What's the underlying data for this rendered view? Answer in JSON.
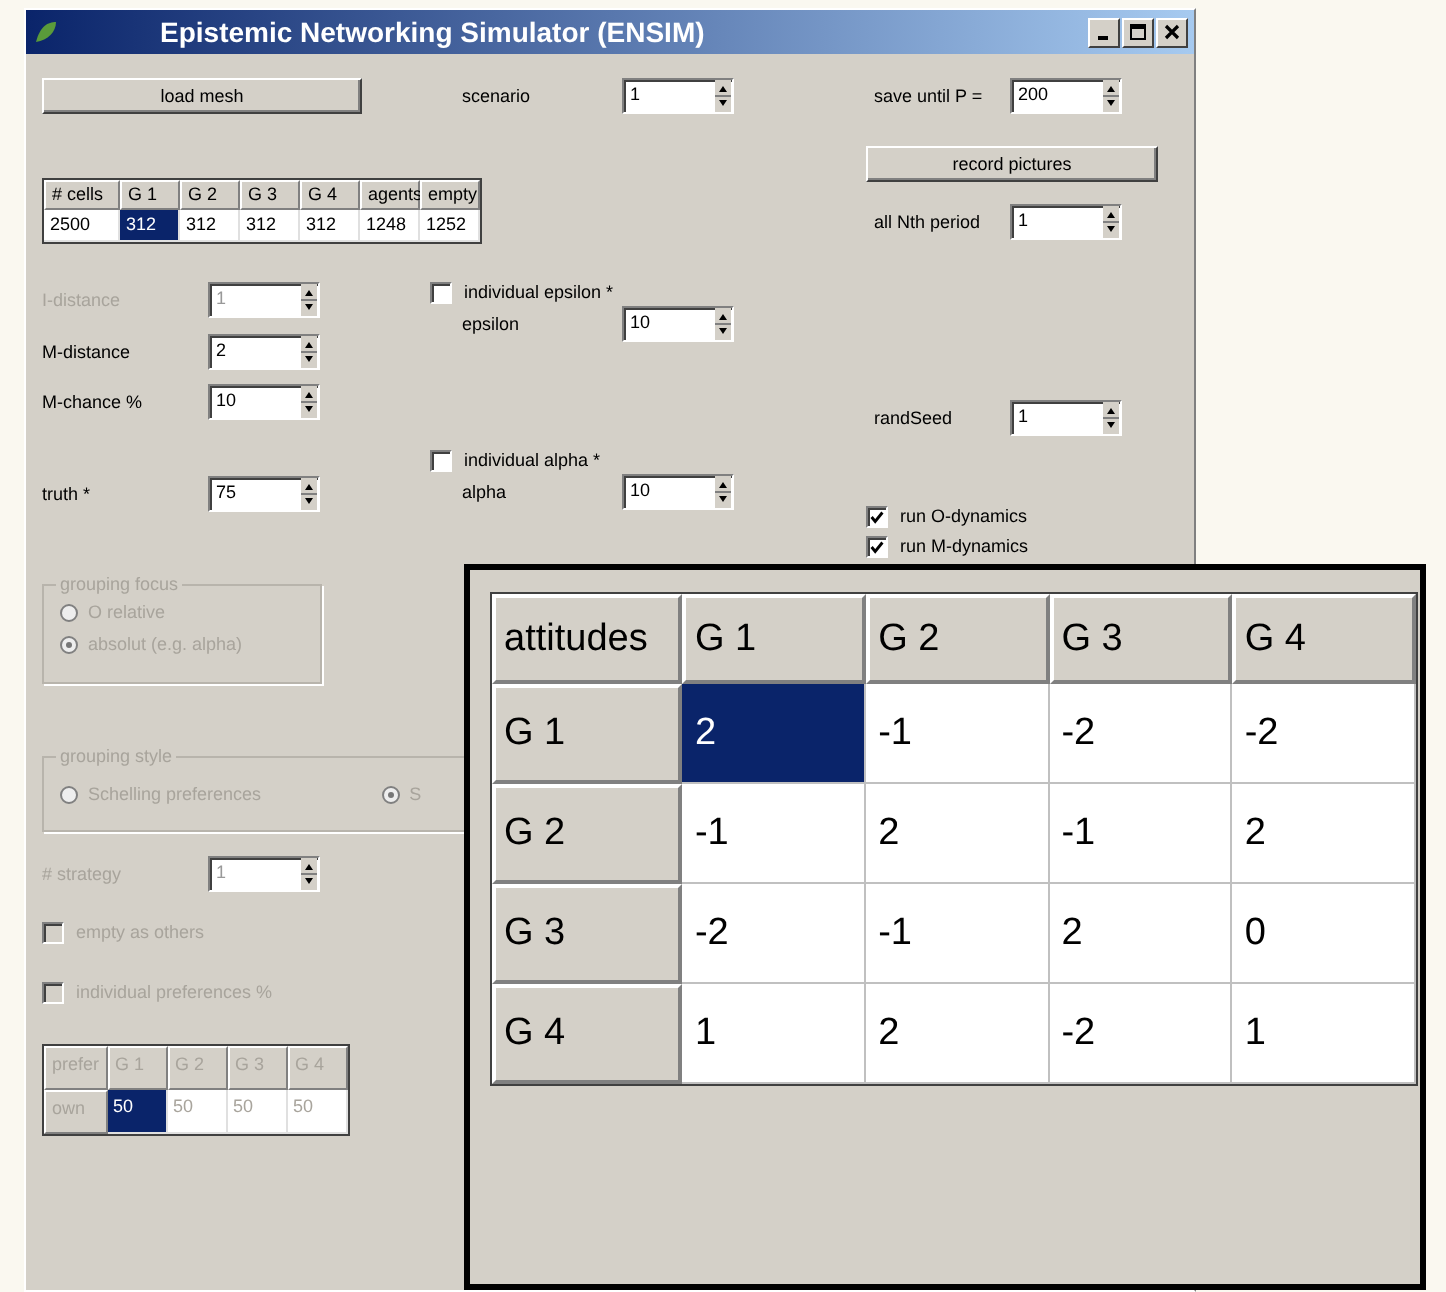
{
  "window": {
    "title": "Epistemic Networking Simulator (ENSIM)"
  },
  "load_button": {
    "label": "load mesh"
  },
  "scenario": {
    "label": "scenario",
    "value": "1"
  },
  "save_until": {
    "label": "save until P =",
    "value": "200"
  },
  "record_button": {
    "label": "record pictures"
  },
  "nth_period": {
    "label": "all Nth period",
    "value": "1"
  },
  "stats_table": {
    "columns": [
      "# cells",
      "G 1",
      "G 2",
      "G 3",
      "G 4",
      "agents",
      "empty"
    ],
    "rows": [
      {
        "cells": [
          {
            "text": "2500",
            "selected": false
          },
          {
            "text": "312",
            "selected": true
          },
          {
            "text": "312",
            "selected": false
          },
          {
            "text": "312",
            "selected": false
          },
          {
            "text": "312",
            "selected": false
          },
          {
            "text": "1248",
            "selected": false
          },
          {
            "text": "1252",
            "selected": false
          }
        ]
      }
    ]
  },
  "left_spinners": [
    {
      "label": "I-distance",
      "value": "1",
      "disabled": true
    },
    {
      "label": "M-distance",
      "value": "2",
      "disabled": false
    },
    {
      "label": "M-chance %",
      "value": "10",
      "disabled": false
    },
    {
      "label": "truth *",
      "value": "75",
      "disabled": false
    }
  ],
  "epsilon": {
    "checkbox": {
      "label": "individual epsilon *",
      "checked": false
    },
    "label": "epsilon",
    "value": "10"
  },
  "alpha": {
    "checkbox": {
      "label": "individual alpha *",
      "checked": false
    },
    "label": "alpha",
    "value": "10"
  },
  "rand_seed": {
    "label": "randSeed",
    "value": "1"
  },
  "dynamics": [
    {
      "label": "run O-dynamics",
      "checked": true
    },
    {
      "label": "run M-dynamics",
      "checked": true
    }
  ],
  "grouping_focus": {
    "title": "grouping focus",
    "disabled": true,
    "options": [
      {
        "label": "O relative",
        "selected": false
      },
      {
        "label": "absolut (e.g. alpha)",
        "selected": true
      }
    ]
  },
  "grouping_style": {
    "title": "grouping style",
    "disabled": true,
    "options": [
      {
        "label": "Schelling preferences",
        "selected": false
      },
      {
        "label": "S",
        "selected": true
      }
    ]
  },
  "strategy": {
    "label": "# strategy",
    "value": "1",
    "disabled": true
  },
  "options": [
    {
      "label": "empty as others",
      "checked": false,
      "disabled": true
    },
    {
      "label": "individual preferences %",
      "checked": false,
      "disabled": true
    }
  ],
  "pref_table": {
    "corner": "prefer",
    "columns": [
      "G 1",
      "G 2",
      "G 3",
      "G 4"
    ],
    "rows": [
      {
        "header": "own",
        "cells": [
          {
            "text": "50",
            "selected": true
          },
          {
            "text": "50",
            "selected": false
          },
          {
            "text": "50",
            "selected": false
          },
          {
            "text": "50",
            "selected": false
          }
        ]
      }
    ]
  },
  "attitudes_table": {
    "corner": "attitudes",
    "columns": [
      "G 1",
      "G 2",
      "G 3",
      "G 4"
    ],
    "rows": [
      {
        "header": "G 1",
        "cells": [
          {
            "text": "2",
            "selected": true
          },
          {
            "text": "-1",
            "selected": false
          },
          {
            "text": "-2",
            "selected": false
          },
          {
            "text": "-2",
            "selected": false
          }
        ]
      },
      {
        "header": "G 2",
        "cells": [
          {
            "text": "-1",
            "selected": false
          },
          {
            "text": "2",
            "selected": false
          },
          {
            "text": "-1",
            "selected": false
          },
          {
            "text": "2",
            "selected": false
          }
        ]
      },
      {
        "header": "G 3",
        "cells": [
          {
            "text": "-2",
            "selected": false
          },
          {
            "text": "-1",
            "selected": false
          },
          {
            "text": "2",
            "selected": false
          },
          {
            "text": "0",
            "selected": false
          }
        ]
      },
      {
        "header": "G 4",
        "cells": [
          {
            "text": "1",
            "selected": false
          },
          {
            "text": "2",
            "selected": false
          },
          {
            "text": "-2",
            "selected": false
          },
          {
            "text": "1",
            "selected": false
          }
        ]
      }
    ]
  }
}
